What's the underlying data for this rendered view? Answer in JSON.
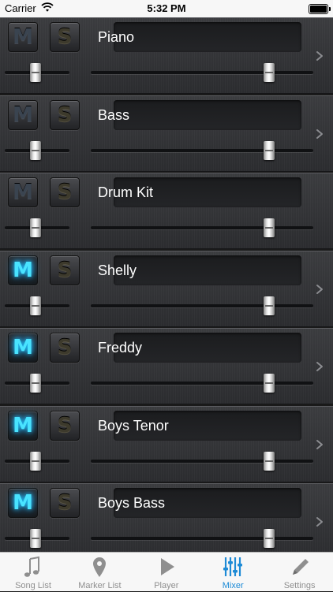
{
  "status_bar": {
    "carrier": "Carrier",
    "time": "5:32 PM",
    "battery_level": 1.0
  },
  "mixer": {
    "mute_label": "M",
    "solo_label": "S",
    "channels": [
      {
        "name": "Piano",
        "muted": false,
        "soloed": false,
        "pan": 0.48,
        "volume": 0.8,
        "has_detail": true
      },
      {
        "name": "Bass",
        "muted": false,
        "soloed": false,
        "pan": 0.48,
        "volume": 0.8,
        "has_detail": true
      },
      {
        "name": "Drum Kit",
        "muted": false,
        "soloed": false,
        "pan": 0.48,
        "volume": 0.8,
        "has_detail": false
      },
      {
        "name": "Shelly",
        "muted": true,
        "soloed": false,
        "pan": 0.48,
        "volume": 0.8,
        "has_detail": true
      },
      {
        "name": "Freddy",
        "muted": true,
        "soloed": false,
        "pan": 0.48,
        "volume": 0.8,
        "has_detail": true
      },
      {
        "name": "Boys Tenor",
        "muted": true,
        "soloed": false,
        "pan": 0.48,
        "volume": 0.8,
        "has_detail": true
      },
      {
        "name": "Boys Bass",
        "muted": true,
        "soloed": false,
        "pan": 0.48,
        "volume": 0.8,
        "has_detail": true
      }
    ]
  },
  "tab_bar": {
    "active": "Mixer",
    "active_color": "#1e8bd6",
    "tabs": [
      {
        "label": "Song List",
        "icon": "music-note-icon"
      },
      {
        "label": "Marker List",
        "icon": "map-pin-icon"
      },
      {
        "label": "Player",
        "icon": "play-icon"
      },
      {
        "label": "Mixer",
        "icon": "mixer-sliders-icon"
      },
      {
        "label": "Settings",
        "icon": "pencil-icon"
      }
    ]
  }
}
